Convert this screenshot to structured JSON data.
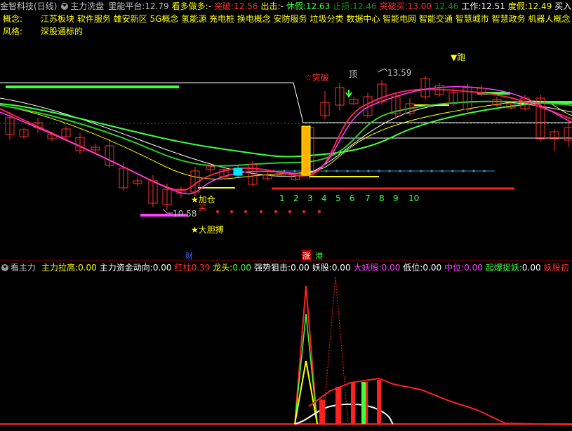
{
  "header": {
    "app_name": "金智科技",
    "period": "(日线)",
    "indicator": "主力洗盘",
    "fields": [
      {
        "label": "里能平台:",
        "value": "12.79",
        "lc": "#c0c0c0",
        "vc": "#c0c0c0"
      },
      {
        "label": "看多做多:",
        "value": "-",
        "lc": "#ffff00",
        "vc": "#c0c0c0"
      },
      {
        "label": "突破:",
        "value": "12.56",
        "lc": "#ff3030",
        "vc": "#ff3030"
      },
      {
        "label": "出击:",
        "value": "-",
        "lc": "#ffff00",
        "vc": "#c0c0c0"
      },
      {
        "label": "休假:",
        "value": "12.63",
        "lc": "#40ff40",
        "vc": "#40ff40"
      },
      {
        "label": "止损:",
        "value": "12.46",
        "lc": "#1a8a1a",
        "vc": "#1a8a1a"
      },
      {
        "label": "突破买:",
        "value": "13.00",
        "lc": "#ff3030",
        "vc": "#ff3030"
      },
      {
        "label": "",
        "value": "12.46",
        "lc": "#1a8a1a",
        "vc": "#1a8a1a"
      },
      {
        "label": "工作:",
        "value": "12.51",
        "lc": "#ffffff",
        "vc": "#ffffff"
      },
      {
        "label": "度假:",
        "value": "12.49",
        "lc": "#ffff00",
        "vc": "#ffff00"
      },
      {
        "label": "买入",
        "value": "",
        "lc": "#ffffff",
        "vc": "#ffffff"
      }
    ],
    "concept_label": "概念:",
    "concepts": "江苏板块  软件服务  雄安新区  5G概念  氢能源  充电桩  换电概念  安防服务  垃圾分类  数据中心  智能电网  智能交通  智慧城市  智慧政务  机器人概念  人工智",
    "style_label": "风格:",
    "style": "深股通标的"
  },
  "main_annotations": {
    "tupo": "☆突破",
    "ding": "顶",
    "high_price": "13.59",
    "low_price": "10.58",
    "pao": "▼跑",
    "jiacang": "★加仓",
    "mai": "买",
    "dadanbo": "★大胆搏",
    "cai": "财",
    "zhang": "涨",
    "gang": "港",
    "day_counter": [
      "1",
      "2",
      "3",
      "4",
      "5",
      "6",
      "7",
      "8",
      "9",
      "10"
    ]
  },
  "sub_header": {
    "title": "看主力",
    "fields": [
      {
        "label": "主力拉高:",
        "value": "0.00",
        "lc": "#ffff00",
        "vc": "#ffff00"
      },
      {
        "label": "主力资金动向:",
        "value": "0.00",
        "lc": "#ffffff",
        "vc": "#ffffff"
      },
      {
        "label": "红柱",
        "value": "0.39",
        "lc": "#ff3030",
        "vc": "#ff3030"
      },
      {
        "label": "龙头:",
        "value": "0.00",
        "lc": "#ffff00",
        "vc": "#40ff40"
      },
      {
        "label": "强势狙击:",
        "value": "0.00",
        "lc": "#ffffff",
        "vc": "#ffffff"
      },
      {
        "label": "妖股:",
        "value": "0.00",
        "lc": "#ffffff",
        "vc": "#ffffff"
      },
      {
        "label": "大妖股:",
        "value": "0.00",
        "lc": "#ff40ff",
        "vc": "#ff40ff"
      },
      {
        "label": "低位:",
        "value": "0.00",
        "lc": "#ffffff",
        "vc": "#ffffff"
      },
      {
        "label": "中位:",
        "value": "0.00",
        "lc": "#ff40ff",
        "vc": "#ff40ff"
      },
      {
        "label": "起爆捉妖:",
        "value": "0.00",
        "lc": "#40ff40",
        "vc": "#ffffff"
      },
      {
        "label": "妖股初",
        "value": "",
        "lc": "#ff3030",
        "vc": "#ff3030"
      }
    ]
  },
  "colors": {
    "up": "#ff3030",
    "down": "#00e5ff",
    "background": "#000000",
    "ma_white": "#ffffff",
    "ma_yellow": "#ffff00",
    "ma_green": "#40ff40",
    "ma_magenta": "#ff40ff"
  }
}
